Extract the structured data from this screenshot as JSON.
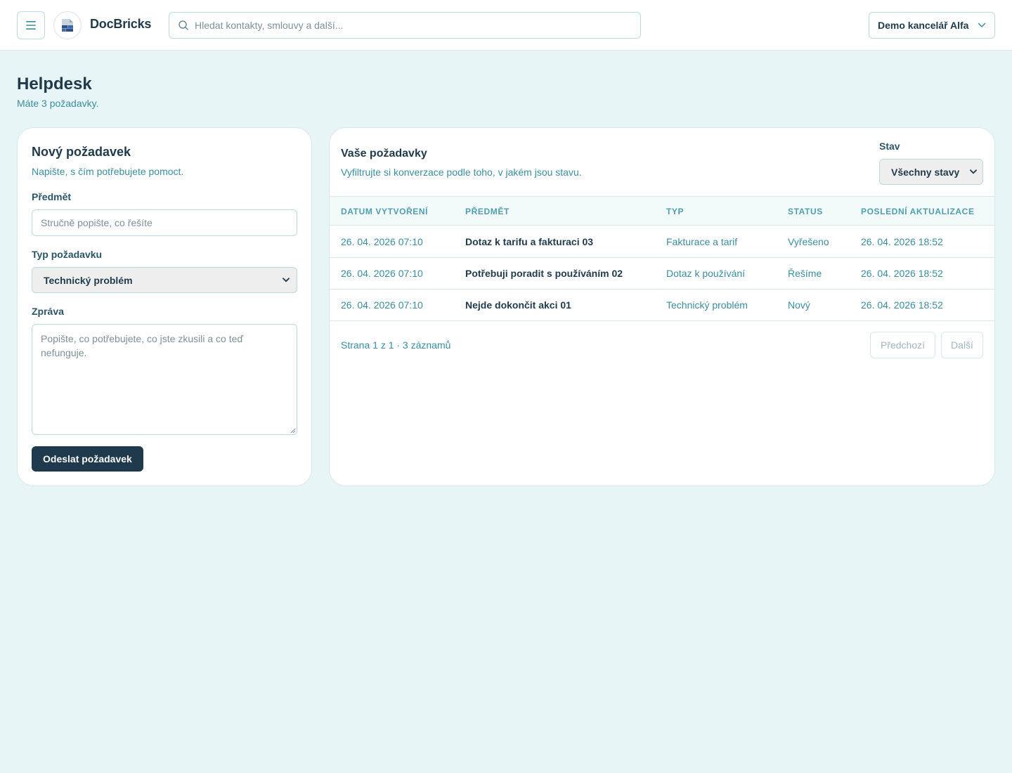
{
  "app": {
    "brand": "DocBricks",
    "search_placeholder": "Hledat kontakty, smlouvy a další...",
    "office": "Demo kancelář Alfa"
  },
  "page": {
    "title": "Helpdesk",
    "subtitle": "Máte 3 požadavky."
  },
  "new_request": {
    "title": "Nový požadavek",
    "subtitle": "Napište, s čím potřebujete pomoct.",
    "subject_label": "Předmět",
    "subject_placeholder": "Stručně popište, co řešíte",
    "subject_value": "",
    "type_label": "Typ požadavku",
    "type_value": "Technický problém",
    "message_label": "Zpráva",
    "message_placeholder": "Popište, co potřebujete, co jste zkusili a co teď nefunguje.",
    "submit_label": "Odeslat požadavek"
  },
  "requests": {
    "title": "Vaše požadavky",
    "subtitle": "Vyfiltrujte si konverzace podle toho, v jakém jsou stavu.",
    "filter_label": "Stav",
    "filter_value": "Všechny stavy",
    "columns": [
      "Datum vytvoření",
      "Předmět",
      "Typ",
      "Status",
      "Poslední aktualizace"
    ],
    "rows": [
      {
        "created": "26. 04. 2026 07:10",
        "subject": "Dotaz k tarifu a fakturaci 03",
        "type": "Fakturace a tarif",
        "status": "Vyřešeno",
        "updated": "26. 04. 2026 18:52"
      },
      {
        "created": "26. 04. 2026 07:10",
        "subject": "Potřebuji poradit s používáním 02",
        "type": "Dotaz k používání",
        "status": "Řešíme",
        "updated": "26. 04. 2026 18:52"
      },
      {
        "created": "26. 04. 2026 07:10",
        "subject": "Nejde dokončit akci 01",
        "type": "Technický problém",
        "status": "Nový",
        "updated": "26. 04. 2026 18:52"
      }
    ],
    "pagination_info": "Strana 1 z 1 · 3 záznamů",
    "prev_label": "Předchozí",
    "next_label": "Další"
  },
  "icons": {
    "menu": "menu-icon",
    "logo": "docbricks-logo-icon",
    "search": "search-icon",
    "chevron": "chevron-down-icon"
  },
  "colors": {
    "background": "#e8f5f6",
    "accent": "#3a8d9f",
    "primary_button": "#1e3a4c",
    "text": "#1f3a4a"
  }
}
